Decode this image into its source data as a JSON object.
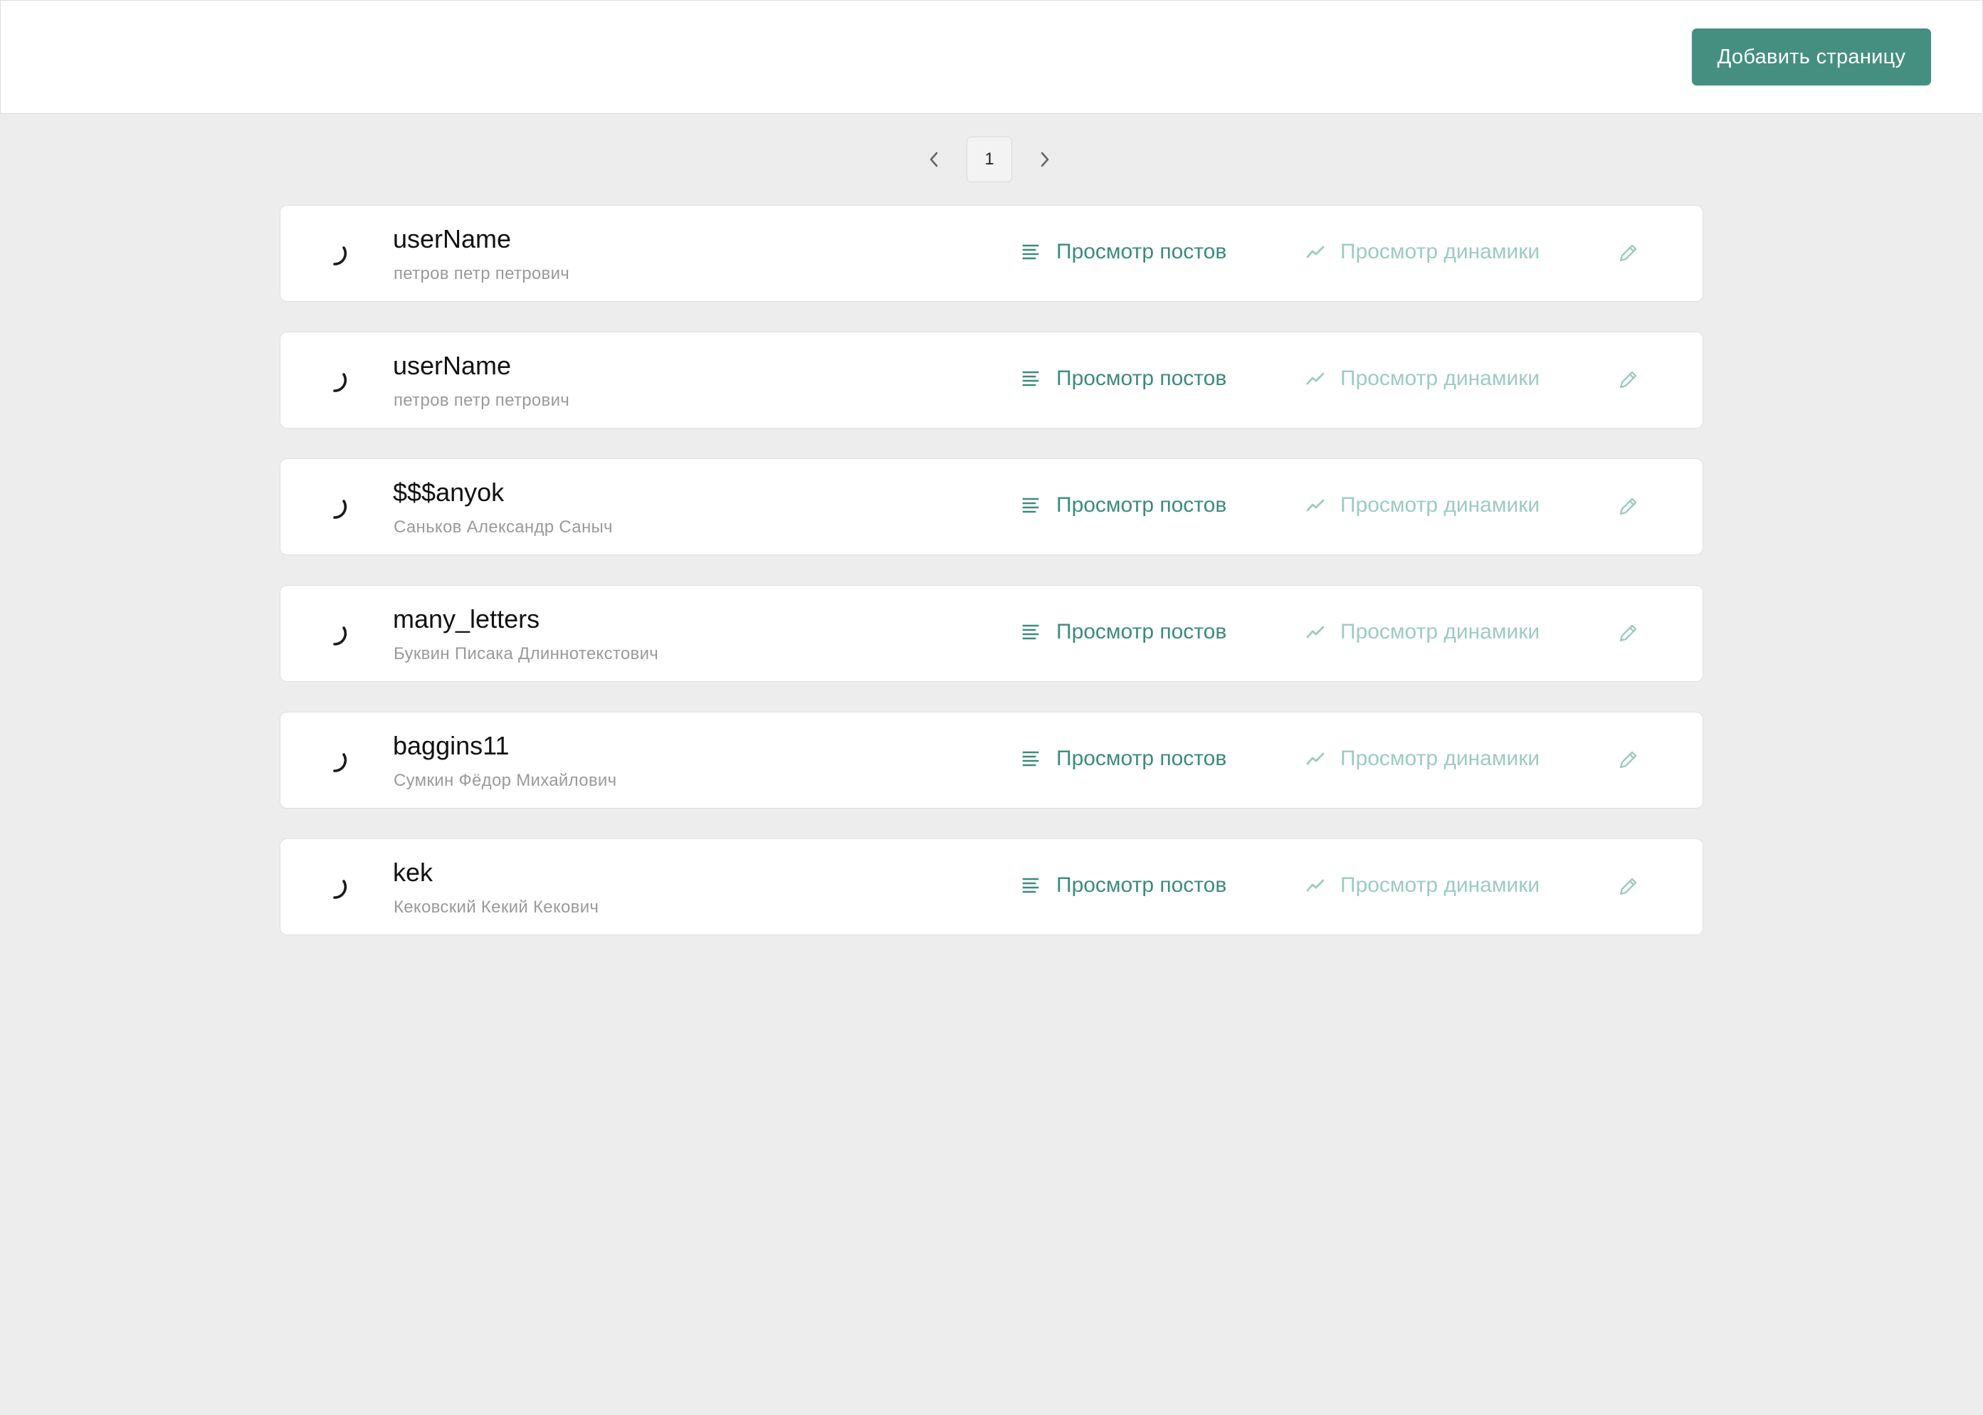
{
  "colors": {
    "accent": "#458f80",
    "link": "#3b8b7c",
    "link_muted": "#9ccbc1",
    "background": "#ededed"
  },
  "header": {
    "add_page_label": "Добавить страницу"
  },
  "pagination": {
    "current_page": "1",
    "prev_icon": "chevron-left-icon",
    "next_icon": "chevron-right-icon"
  },
  "actions": {
    "posts_label": "Просмотр постов",
    "posts_icon": "text-lines-icon",
    "dynamics_label": "Просмотр динамики",
    "dynamics_icon": "trend-line-icon",
    "edit_icon": "pencil-icon",
    "loading_icon": "spinner-icon"
  },
  "pages": [
    {
      "username": "userName",
      "full_name": "петров петр петрович"
    },
    {
      "username": "userName",
      "full_name": "петров петр петрович"
    },
    {
      "username": "$$$anyok",
      "full_name": "Саньков Александр Саныч"
    },
    {
      "username": "many_letters",
      "full_name": "Буквин Писака Длиннотекстович"
    },
    {
      "username": "baggins11",
      "full_name": "Сумкин Фёдор Михайлович"
    },
    {
      "username": "kek",
      "full_name": "Кековский Кекий Кекович"
    }
  ]
}
